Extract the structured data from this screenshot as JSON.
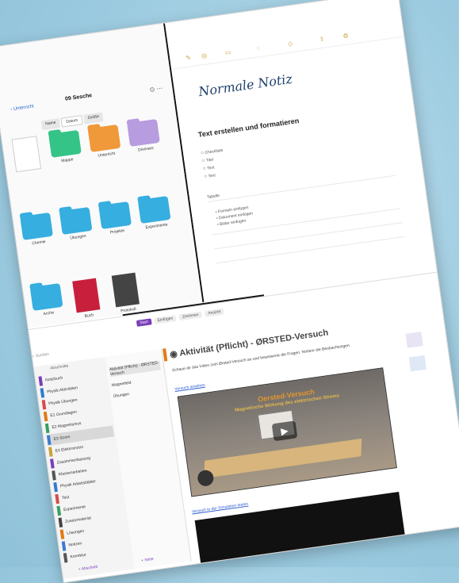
{
  "files": {
    "back_label": "Unterricht",
    "title": "09 Sesche",
    "segments": [
      "Name",
      "Datum",
      "Größe"
    ],
    "items": [
      {
        "label": "",
        "kind": "doc",
        "color": ""
      },
      {
        "label": "Mappe",
        "kind": "folder",
        "color": "#35c487"
      },
      {
        "label": "Unterricht",
        "kind": "folder",
        "color": "#f0993a"
      },
      {
        "label": "Diverses",
        "kind": "folder",
        "color": "#b79cdf"
      },
      {
        "label": "Chemie",
        "kind": "folder",
        "color": "#36aee0"
      },
      {
        "label": "Übungen",
        "kind": "folder",
        "color": "#36aee0"
      },
      {
        "label": "Projekte",
        "kind": "folder",
        "color": "#36aee0"
      },
      {
        "label": "Experimente",
        "kind": "folder",
        "color": "#36aee0"
      },
      {
        "label": "Archiv",
        "kind": "folder",
        "color": "#36aee0"
      },
      {
        "label": "Buch",
        "kind": "cover",
        "color": "#c8203c"
      },
      {
        "label": "Protokoll",
        "kind": "cover",
        "color": "#444444"
      }
    ]
  },
  "note": {
    "handwriting": "Normale Notiz",
    "title": "Text erstellen und formatieren",
    "options": [
      "Checkliste",
      "Titel",
      "Text",
      "Text"
    ],
    "tabelle": "Tabelle",
    "bullets": [
      "Formeln einfügen",
      "Dokument einfügen",
      "Bilder einfügen"
    ]
  },
  "lower": {
    "tabs": [
      "Start",
      "Einfügen",
      "Zeichnen",
      "Ansicht"
    ],
    "search_placeholder": "Suchen",
    "sections_header": "Abschnitte",
    "sections": [
      {
        "label": "Notizbuch",
        "color": "#7a3db8"
      },
      {
        "label": "Physik Aktivitäten",
        "color": "#2f7bd0"
      },
      {
        "label": "Physik Übungen",
        "color": "#d94b4b"
      },
      {
        "label": "E1 Grundlagen",
        "color": "#e07a16"
      },
      {
        "label": "E2 Magnetismus",
        "color": "#35a060"
      },
      {
        "label": "E3 Strom",
        "color": "#3b7bd0"
      },
      {
        "label": "E4 Elektromotor",
        "color": "#c8a23c"
      },
      {
        "label": "Zusammenfassung",
        "color": "#7a3db8"
      },
      {
        "label": "Klassenarbeiten",
        "color": "#555555"
      },
      {
        "label": "Physik Arbeitsblätter",
        "color": "#2f7bd0"
      },
      {
        "label": "Test",
        "color": "#d94b4b"
      },
      {
        "label": "Experimente",
        "color": "#35a060"
      },
      {
        "label": "Zusatzmaterial",
        "color": "#444444"
      },
      {
        "label": "Lösungen",
        "color": "#e07a16"
      },
      {
        "label": "Notizen",
        "color": "#3b7bd0"
      },
      {
        "label": "Korrektur",
        "color": "#555555"
      }
    ],
    "sections_footer": "Abschnitt",
    "pages": [
      "Aktivität (Pflicht) - ØRSTED-Versuch",
      "Magnetfeld",
      "Übungen"
    ],
    "pages_footer": "Seite",
    "page_title": "Aktivität (Pflicht) - ØRSTED-Versuch",
    "desc": "Schaue dir das Video zum Ørsted-Versuch an und beantworte die Fragen. Notiere die Beobachtungen.",
    "link1": "Versuch ansehen",
    "video_title": "Oersted-Versuch",
    "video_sub": "Magnetische Wirkung des elektrischen Stroms",
    "link2": "Versuch in der Simulation testen"
  }
}
